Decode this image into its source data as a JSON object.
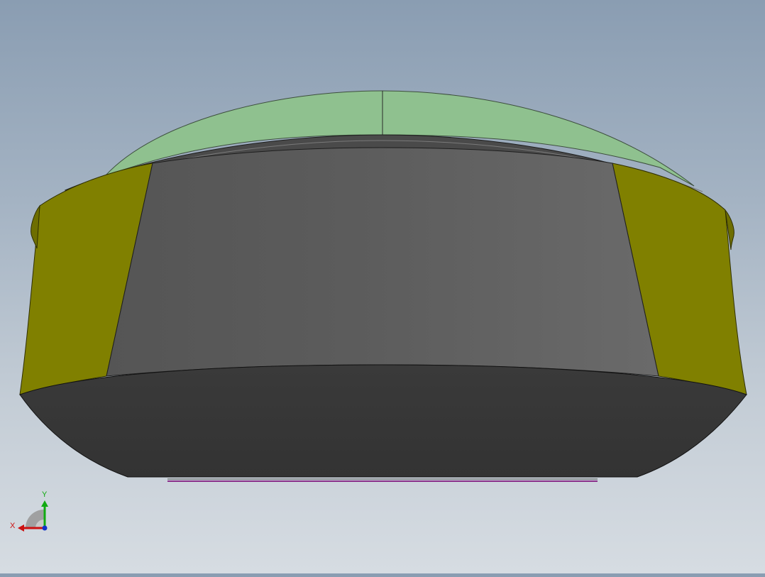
{
  "colors": {
    "background_top": "#8a9db2",
    "background_bottom": "#d6dce2",
    "dome": "#8fc18f",
    "rim": "#4a4a4a",
    "front_face": "#5a5a5a",
    "side_panels": "#808000",
    "bottom_face": "#383838",
    "base_edge": "#8a2f8a",
    "axis_x": "#cc1111",
    "axis_y": "#11aa11",
    "axis_z": "#1133cc"
  },
  "triad": {
    "x_label": "X",
    "y_label": "Y"
  }
}
